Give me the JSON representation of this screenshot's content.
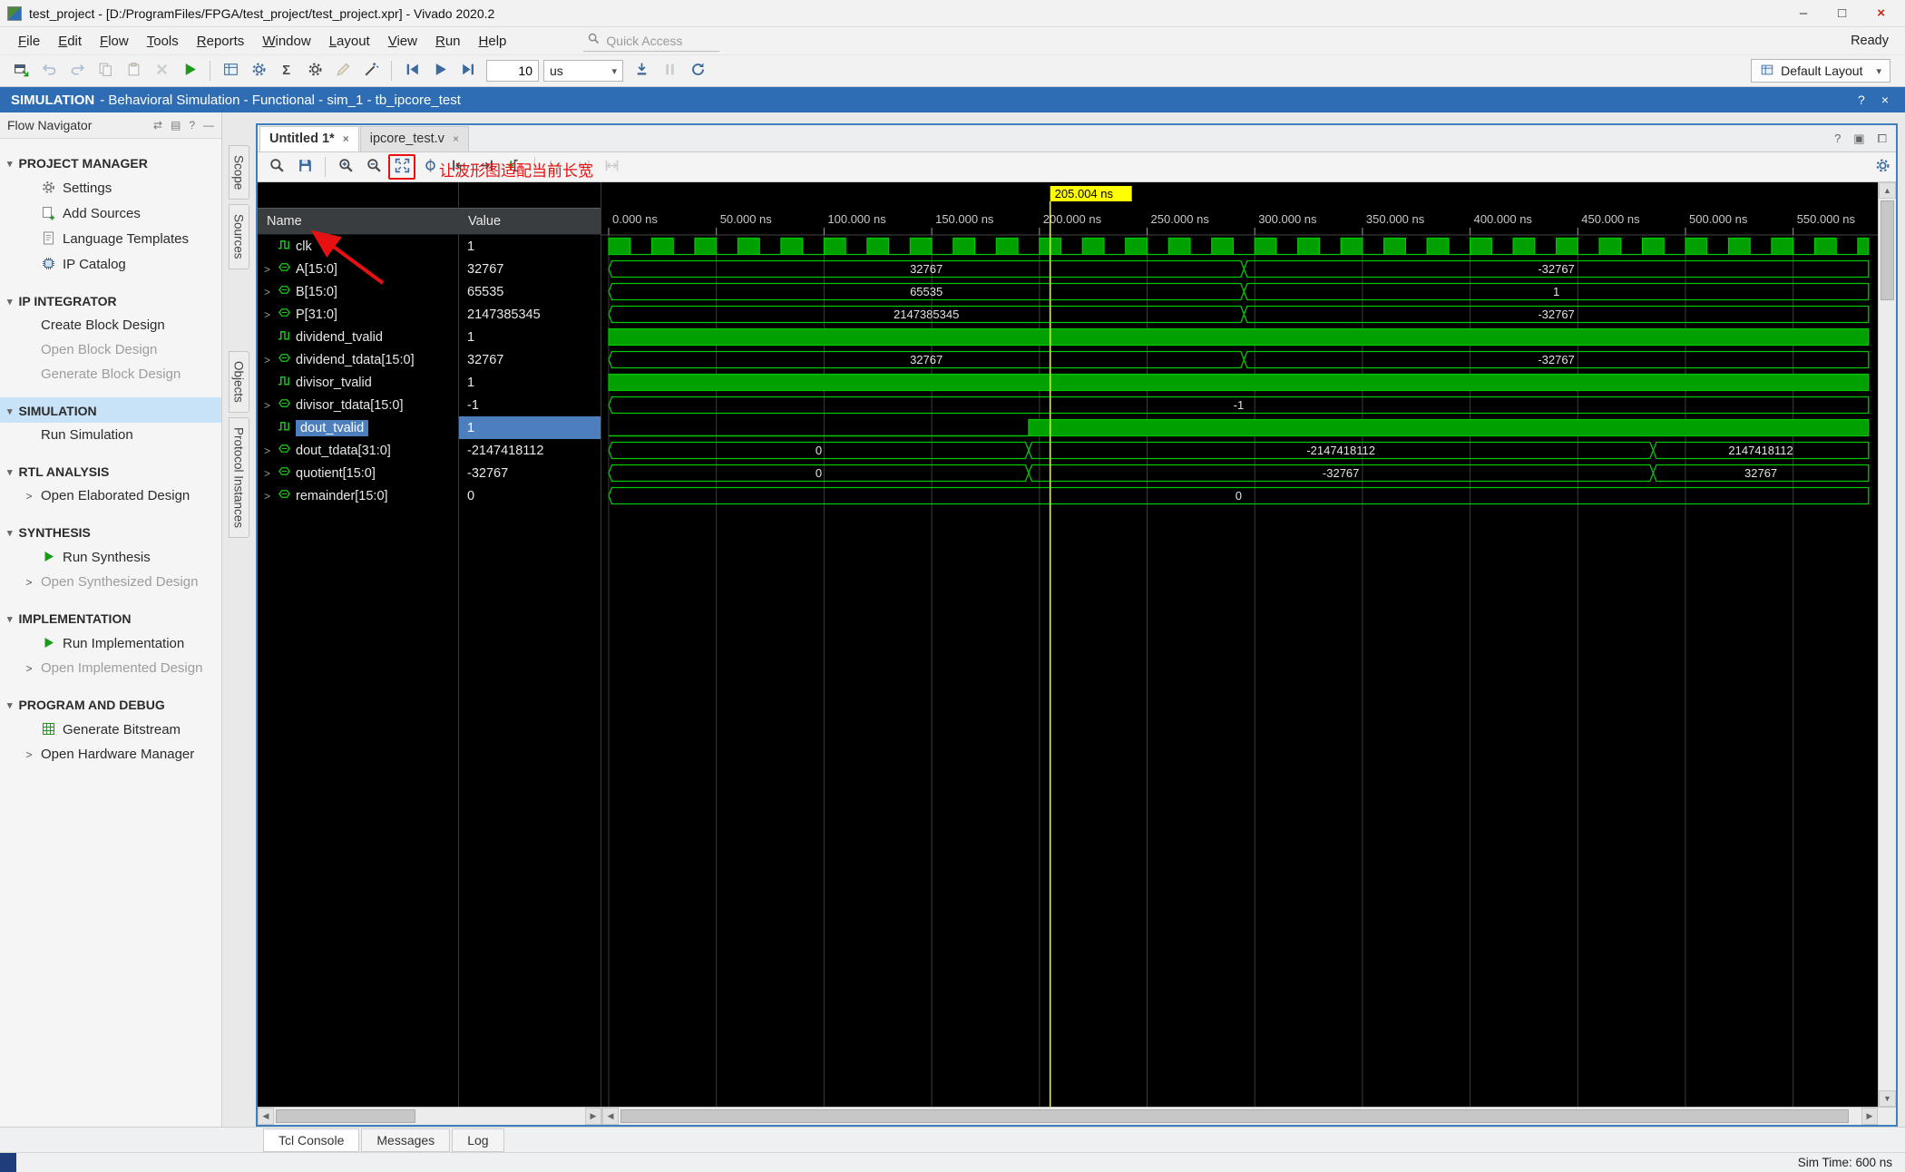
{
  "colors": {
    "wave_green": "#00c800",
    "wave_green_fill": "#00a000",
    "cursor_yellow": "#ffff00",
    "selection_blue": "#4d7fbe",
    "context_blue": "#2e6db4",
    "annotation_red": "#e81111",
    "grid_gray": "#3c3c3c"
  },
  "window": {
    "title": "test_project - [D:/ProgramFiles/FPGA/test_project/test_project.xpr] - Vivado 2020.2",
    "controls": {
      "minimize": "–",
      "maximize": "□",
      "close": "×"
    },
    "ready": "Ready"
  },
  "menu_bar": {
    "items": [
      "File",
      "Edit",
      "Flow",
      "Tools",
      "Reports",
      "Window",
      "Layout",
      "View",
      "Run",
      "Help"
    ],
    "quick_access_placeholder": "Quick Access"
  },
  "main_toolbar": {
    "buttons": [
      {
        "name": "open-window",
        "glyph": "window"
      },
      {
        "name": "undo",
        "glyph": "undo",
        "disabled": true
      },
      {
        "name": "redo",
        "glyph": "redo",
        "disabled": true
      },
      {
        "name": "copy",
        "glyph": "copy",
        "disabled": true
      },
      {
        "name": "paste",
        "glyph": "paste",
        "disabled": true
      },
      {
        "name": "delete",
        "glyph": "delete",
        "disabled": true
      },
      {
        "name": "run",
        "glyph": "play"
      },
      {
        "sep": true
      },
      {
        "name": "simulation-dashboard",
        "glyph": "dashboard"
      },
      {
        "name": "simulation-settings",
        "glyph": "gear"
      },
      {
        "name": "add-scope",
        "glyph": "sigma"
      },
      {
        "name": "breakpoints",
        "glyph": "gear2"
      },
      {
        "name": "edit",
        "glyph": "pencil",
        "disabled": true
      },
      {
        "name": "probe",
        "glyph": "probe"
      },
      {
        "sep": true
      },
      {
        "name": "restart-simulation",
        "glyph": "restart"
      },
      {
        "name": "run-all",
        "glyph": "playall"
      },
      {
        "name": "run-for",
        "glyph": "playfor"
      }
    ],
    "runtime_value": "10",
    "runtime_unit": "us",
    "after_buttons": [
      {
        "name": "step",
        "glyph": "step"
      },
      {
        "name": "break",
        "glyph": "pause",
        "disabled": true
      },
      {
        "name": "relaunch-simulation",
        "glyph": "relaunch"
      }
    ],
    "layout_label": "Default Layout"
  },
  "context_bar": {
    "title": "SIMULATION",
    "subtitle": "- Behavioral Simulation - Functional - sim_1 - tb_ipcore_test",
    "help": "?",
    "close": "×"
  },
  "flow_navigator": {
    "title": "Flow Navigator",
    "header_icons": [
      "⇄",
      "▤",
      "?",
      "—"
    ],
    "sections": [
      {
        "label": "PROJECT MANAGER",
        "items": [
          {
            "label": "Settings",
            "icon": "gear"
          },
          {
            "label": "Add Sources",
            "icon": "add"
          },
          {
            "label": "Language Templates",
            "icon": "doc"
          },
          {
            "label": "IP Catalog",
            "icon": "chip"
          }
        ]
      },
      {
        "label": "IP INTEGRATOR",
        "items": [
          {
            "label": "Create Block Design"
          },
          {
            "label": "Open Block Design",
            "disabled": true
          },
          {
            "label": "Generate Block Design",
            "disabled": true
          }
        ]
      },
      {
        "label": "SIMULATION",
        "selected": true,
        "items": [
          {
            "label": "Run Simulation"
          }
        ]
      },
      {
        "label": "RTL ANALYSIS",
        "items": [
          {
            "label": "Open Elaborated Design",
            "expandable": true
          }
        ]
      },
      {
        "label": "SYNTHESIS",
        "items": [
          {
            "label": "Run Synthesis",
            "icon": "play"
          },
          {
            "label": "Open Synthesized Design",
            "expandable": true,
            "disabled": true
          }
        ]
      },
      {
        "label": "IMPLEMENTATION",
        "items": [
          {
            "label": "Run Implementation",
            "icon": "play"
          },
          {
            "label": "Open Implemented Design",
            "expandable": true,
            "disabled": true
          }
        ]
      },
      {
        "label": "PROGRAM AND DEBUG",
        "items": [
          {
            "label": "Generate Bitstream",
            "icon": "bits"
          },
          {
            "label": "Open Hardware Manager",
            "expandable": true
          }
        ]
      }
    ]
  },
  "workspace": {
    "side_tabs": [
      "Scope",
      "Sources",
      "Objects",
      "Protocol Instances"
    ],
    "tabs": [
      {
        "label": "Untitled 1*",
        "active": true,
        "close": "×"
      },
      {
        "label": "ipcore_test.v",
        "active": false,
        "close": "×"
      }
    ],
    "tabbar_icons": [
      "?",
      "▣",
      "⧠"
    ]
  },
  "wave_window": {
    "annotation": "让波形图适配当前长宽",
    "toolbar": [
      {
        "name": "find",
        "glyph": "search"
      },
      {
        "name": "save-waveform-configuration",
        "glyph": "floppy"
      },
      {
        "sep": true
      },
      {
        "name": "zoom-in",
        "glyph": "zoomin"
      },
      {
        "name": "zoom-out",
        "glyph": "zoomout"
      },
      {
        "name": "zoom-fit",
        "glyph": "zoomfit",
        "highlight": true
      },
      {
        "name": "zoom-to-cursor",
        "glyph": "zoomcursor"
      },
      {
        "name": "go-to-previous-transition",
        "glyph": "prevt"
      },
      {
        "name": "go-to-next-transition",
        "glyph": "nextt"
      },
      {
        "name": "add-marker",
        "glyph": "marker"
      },
      {
        "sep": true
      },
      {
        "name": "go-to-time-0",
        "glyph": "gstart",
        "disabled": true
      },
      {
        "name": "go-to-last-time",
        "glyph": "gend",
        "disabled": true
      },
      {
        "name": "swap-cursors",
        "glyph": "interval",
        "disabled": true
      }
    ],
    "settings_icon": {
      "name": "wave-settings",
      "glyph": "gear"
    },
    "columns": {
      "name": "Name",
      "value": "Value"
    },
    "cursor": {
      "label": "205.004 ns",
      "time_ns": 205.004
    },
    "axis": {
      "start_ns": 0,
      "visible_end_ns": 585,
      "tick_step_ns": 50,
      "unit": "ns",
      "tick_labels": [
        "0.000 ns",
        "50.000 ns",
        "100.000 ns",
        "150.000 ns",
        "200.000 ns",
        "250.000 ns",
        "300.000 ns",
        "350.000 ns",
        "400.000 ns",
        "450.000 ns",
        "500.000 ns",
        "550.000 ns"
      ]
    },
    "signals": [
      {
        "name": "clk",
        "value": "1",
        "kind": "clock",
        "period_ns": 20,
        "expandable": false
      },
      {
        "name": "A[15:0]",
        "value": "32767",
        "kind": "bus",
        "expandable": true,
        "segments": [
          {
            "from": 0,
            "to": 295,
            "label": "32767"
          },
          {
            "from": 295,
            "to": 585,
            "label": "-32767"
          }
        ]
      },
      {
        "name": "B[15:0]",
        "value": "65535",
        "kind": "bus",
        "expandable": true,
        "segments": [
          {
            "from": 0,
            "to": 295,
            "label": "65535"
          },
          {
            "from": 295,
            "to": 585,
            "label": "1"
          }
        ]
      },
      {
        "name": "P[31:0]",
        "value": "2147385345",
        "kind": "bus",
        "expandable": true,
        "segments": [
          {
            "from": 0,
            "to": 295,
            "label": "2147385345"
          },
          {
            "from": 295,
            "to": 585,
            "label": "-32767"
          }
        ]
      },
      {
        "name": "dividend_tvalid",
        "value": "1",
        "kind": "bit",
        "expandable": false,
        "segments": [
          {
            "from": 0,
            "to": 585,
            "level": 1
          }
        ]
      },
      {
        "name": "dividend_tdata[15:0]",
        "value": "32767",
        "kind": "bus",
        "expandable": true,
        "segments": [
          {
            "from": 0,
            "to": 295,
            "label": "32767"
          },
          {
            "from": 295,
            "to": 585,
            "label": "-32767"
          }
        ]
      },
      {
        "name": "divisor_tvalid",
        "value": "1",
        "kind": "bit",
        "expandable": false,
        "segments": [
          {
            "from": 0,
            "to": 585,
            "level": 1
          }
        ]
      },
      {
        "name": "divisor_tdata[15:0]",
        "value": "-1",
        "kind": "bus",
        "expandable": true,
        "segments": [
          {
            "from": 0,
            "to": 585,
            "label": "-1"
          }
        ]
      },
      {
        "name": "dout_tvalid",
        "value": "1",
        "kind": "bit",
        "selected": true,
        "expandable": false,
        "segments": [
          {
            "from": 0,
            "to": 195,
            "level": 0
          },
          {
            "from": 195,
            "to": 585,
            "level": 1
          }
        ]
      },
      {
        "name": "dout_tdata[31:0]",
        "value": "-2147418112",
        "kind": "bus",
        "expandable": true,
        "segments": [
          {
            "from": 0,
            "to": 195,
            "label": "0"
          },
          {
            "from": 195,
            "to": 485,
            "label": "-2147418112"
          },
          {
            "from": 485,
            "to": 585,
            "label": "2147418112"
          }
        ]
      },
      {
        "name": "quotient[15:0]",
        "value": "-32767",
        "kind": "bus",
        "expandable": true,
        "segments": [
          {
            "from": 0,
            "to": 195,
            "label": "0"
          },
          {
            "from": 195,
            "to": 485,
            "label": "-32767"
          },
          {
            "from": 485,
            "to": 585,
            "label": "32767"
          }
        ]
      },
      {
        "name": "remainder[15:0]",
        "value": "0",
        "kind": "bus",
        "expandable": true,
        "segments": [
          {
            "from": 0,
            "to": 585,
            "label": "0"
          }
        ]
      }
    ]
  },
  "bottom_panel": {
    "tabs": [
      {
        "label": "Tcl Console",
        "active": true
      },
      {
        "label": "Messages",
        "active": false
      },
      {
        "label": "Log",
        "active": false
      }
    ]
  },
  "status_bar": {
    "sim_time": "Sim Time: 600 ns"
  }
}
